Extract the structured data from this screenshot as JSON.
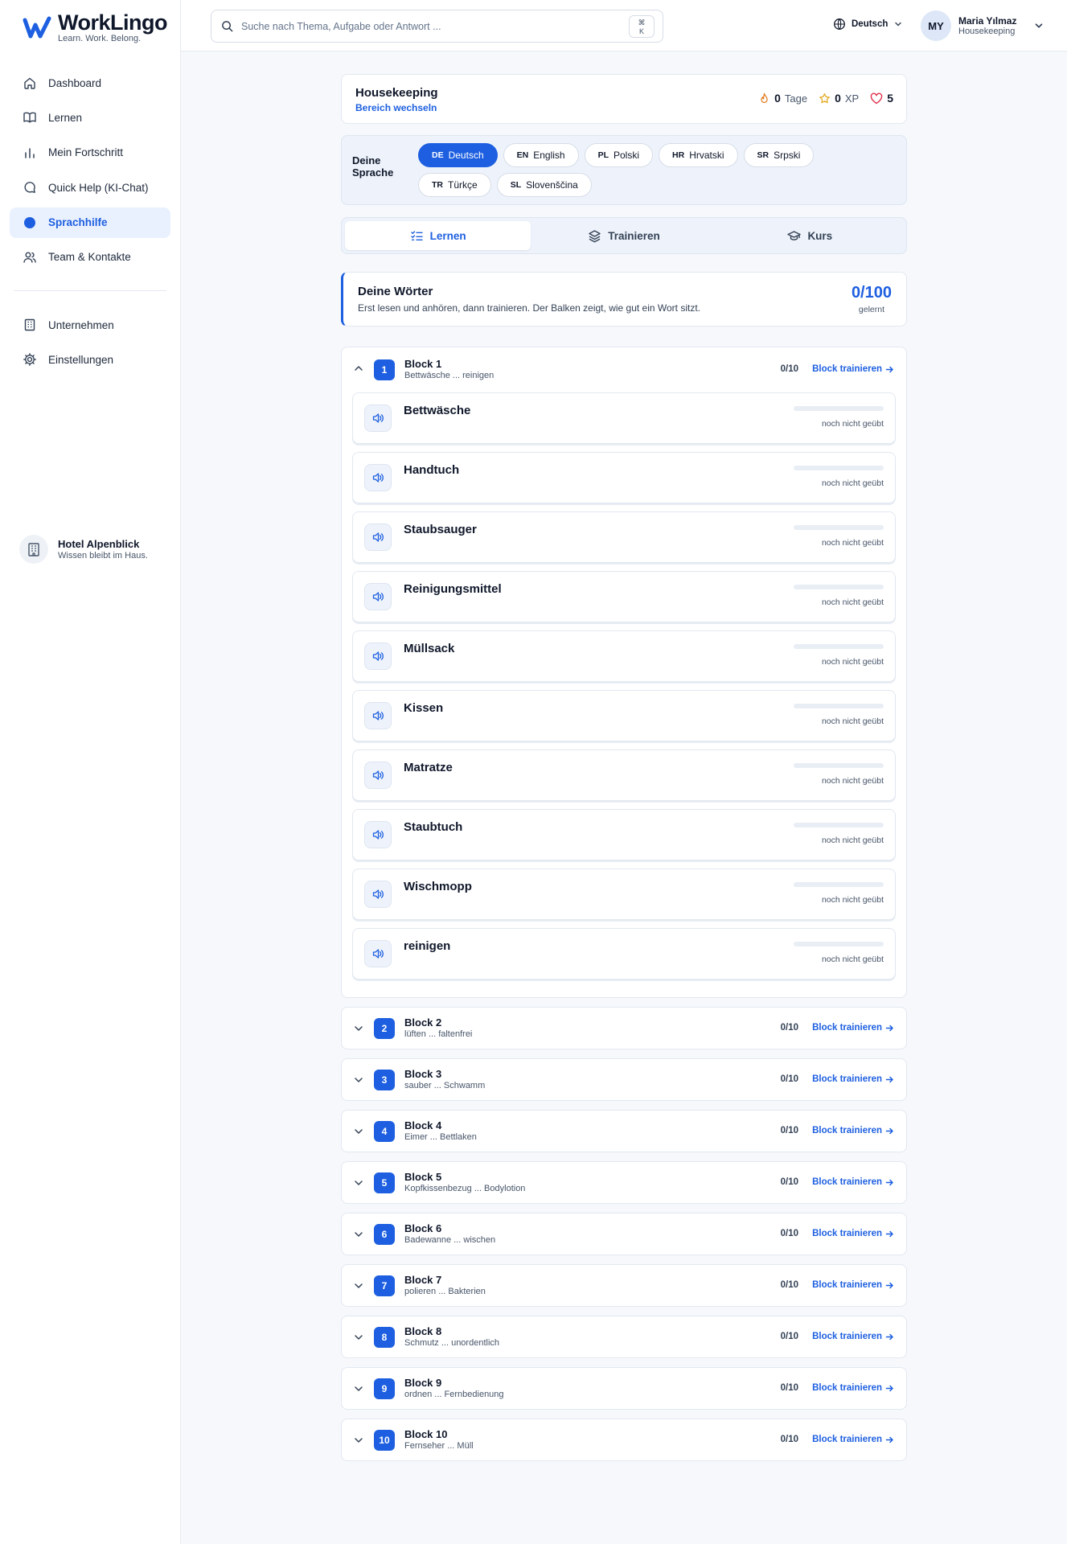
{
  "app": {
    "name": "WorkLingo",
    "tagline": "Learn. Work. Belong."
  },
  "sidebar": {
    "items": [
      {
        "label": "Dashboard",
        "icon": "home-icon"
      },
      {
        "label": "Lernen",
        "icon": "book-icon"
      },
      {
        "label": "Mein Fortschritt",
        "icon": "bar-chart-icon"
      },
      {
        "label": "Quick Help (KI-Chat)",
        "icon": "chat-icon"
      },
      {
        "label": "Sprachhilfe",
        "icon": "dot-icon",
        "active": true
      },
      {
        "label": "Team & Kontakte",
        "icon": "users-icon"
      }
    ],
    "items2": [
      {
        "label": "Unternehmen",
        "icon": "building-icon"
      },
      {
        "label": "Einstellungen",
        "icon": "gear-icon"
      }
    ],
    "org": {
      "name": "Hotel Alpenblick",
      "subtitle": "Wissen bleibt im Haus."
    }
  },
  "topbar": {
    "search_placeholder": "Suche nach Thema, Aufgabe oder Antwort ...",
    "shortcut_top": "⌘",
    "shortcut_bottom": "K",
    "language": "Deutsch",
    "user": {
      "initials": "MY",
      "name": "Maria Yılmaz",
      "role": "Housekeeping"
    }
  },
  "area": {
    "title": "Housekeeping",
    "switch_label": "Bereich wechseln",
    "streak_value": "0",
    "streak_label": "Tage",
    "xp_value": "0",
    "xp_label": "XP",
    "hearts_value": "5"
  },
  "language_panel": {
    "label": "Deine Sprache",
    "languages": [
      {
        "code": "DE",
        "name": "Deutsch",
        "active": true
      },
      {
        "code": "EN",
        "name": "English"
      },
      {
        "code": "PL",
        "name": "Polski"
      },
      {
        "code": "HR",
        "name": "Hrvatski"
      },
      {
        "code": "SR",
        "name": "Srpski"
      },
      {
        "code": "TR",
        "name": "Türkçe"
      },
      {
        "code": "SL",
        "name": "Slovenščina"
      }
    ]
  },
  "tabs": [
    {
      "label": "Lernen",
      "icon": "checklist-icon",
      "active": true
    },
    {
      "label": "Trainieren",
      "icon": "layers-icon"
    },
    {
      "label": "Kurs",
      "icon": "graduation-cap-icon"
    }
  ],
  "words_summary": {
    "title": "Deine Wörter",
    "subtitle": "Erst lesen und anhören, dann trainieren. Der Balken zeigt, wie gut ein Wort sitzt.",
    "count": "0/100",
    "count_label": "gelernt"
  },
  "train_label": "Block trainieren",
  "colors": {
    "accent": "#1d5fe0",
    "accent_soft": "#eaf1fe",
    "bar_track": "#e9eef5"
  },
  "blocks": [
    {
      "number": "1",
      "title": "Block 1",
      "range": "Bettwäsche ... reinigen",
      "progress": "0/10",
      "open": true,
      "words": [
        {
          "word": "Bettwäsche",
          "status": "noch nicht geübt",
          "mastery": 0
        },
        {
          "word": "Handtuch",
          "status": "noch nicht geübt",
          "mastery": 0
        },
        {
          "word": "Staubsauger",
          "status": "noch nicht geübt",
          "mastery": 0
        },
        {
          "word": "Reinigungsmittel",
          "status": "noch nicht geübt",
          "mastery": 0
        },
        {
          "word": "Müllsack",
          "status": "noch nicht geübt",
          "mastery": 0
        },
        {
          "word": "Kissen",
          "status": "noch nicht geübt",
          "mastery": 0
        },
        {
          "word": "Matratze",
          "status": "noch nicht geübt",
          "mastery": 0
        },
        {
          "word": "Staubtuch",
          "status": "noch nicht geübt",
          "mastery": 0
        },
        {
          "word": "Wischmopp",
          "status": "noch nicht geübt",
          "mastery": 0
        },
        {
          "word": "reinigen",
          "status": "noch nicht geübt",
          "mastery": 0
        }
      ]
    },
    {
      "number": "2",
      "title": "Block 2",
      "range": "lüften ... faltenfrei",
      "progress": "0/10"
    },
    {
      "number": "3",
      "title": "Block 3",
      "range": "sauber ... Schwamm",
      "progress": "0/10"
    },
    {
      "number": "4",
      "title": "Block 4",
      "range": "Eimer ... Bettlaken",
      "progress": "0/10"
    },
    {
      "number": "5",
      "title": "Block 5",
      "range": "Kopfkissenbezug ... Bodylotion",
      "progress": "0/10"
    },
    {
      "number": "6",
      "title": "Block 6",
      "range": "Badewanne ... wischen",
      "progress": "0/10"
    },
    {
      "number": "7",
      "title": "Block 7",
      "range": "polieren ... Bakterien",
      "progress": "0/10"
    },
    {
      "number": "8",
      "title": "Block 8",
      "range": "Schmutz ... unordentlich",
      "progress": "0/10"
    },
    {
      "number": "9",
      "title": "Block 9",
      "range": "ordnen ... Fernbedienung",
      "progress": "0/10"
    },
    {
      "number": "10",
      "title": "Block 10",
      "range": "Fernseher ... Müll",
      "progress": "0/10"
    }
  ]
}
